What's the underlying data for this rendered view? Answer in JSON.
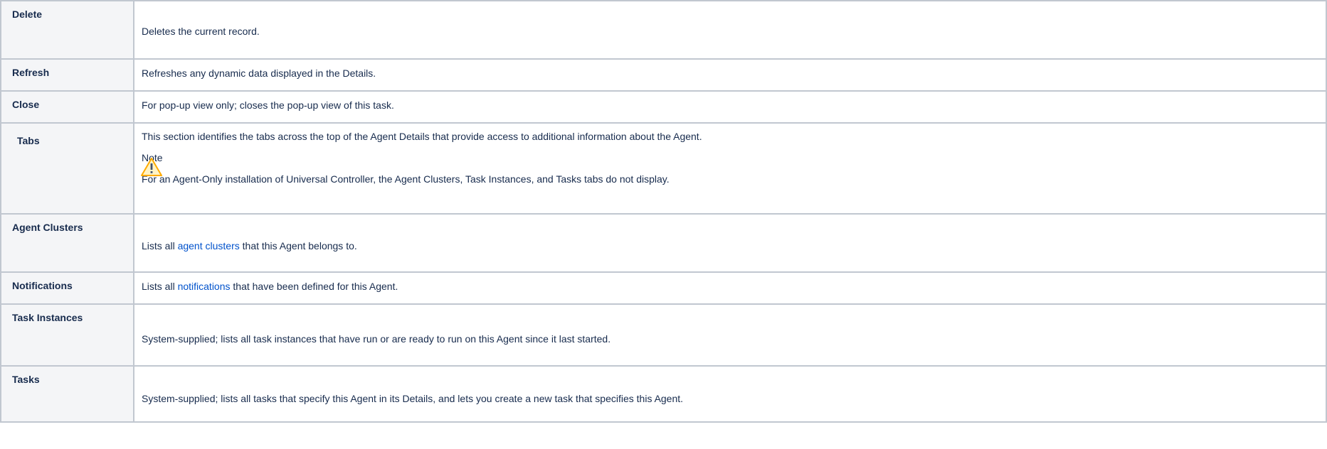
{
  "rows": {
    "delete": {
      "key": "Delete",
      "desc": "Deletes the current record."
    },
    "refresh": {
      "key": "Refresh",
      "desc": "Refreshes any dynamic data displayed in the Details."
    },
    "close": {
      "key": "Close",
      "desc": "For pop-up view only; closes the pop-up view of this task."
    },
    "tabs": {
      "key": "Tabs",
      "desc": "This section identifies the tabs across the top of the Agent Details that provide access to additional information about the Agent.",
      "note_title": "Note",
      "note_icon": "warning-icon",
      "note_body": "For an Agent-Only installation of Universal Controller, the Agent Clusters, Task Instances, and Tasks tabs do not display."
    },
    "agent_clusters": {
      "key": "Agent Clusters",
      "pre": "Lists all ",
      "link": "agent clusters",
      "post": " that this Agent belongs to."
    },
    "notifications": {
      "key": "Notifications",
      "pre": "Lists all ",
      "link": "notifications",
      "post": " that have been defined for this Agent."
    },
    "task_instances": {
      "key": "Task Instances",
      "desc": "System-supplied; lists all task instances that have run or are ready to run on this Agent since it last started."
    },
    "tasks": {
      "key": "Tasks",
      "desc": "System-supplied; lists all tasks that specify this Agent in its Details, and lets you create a new task that specifies this Agent."
    }
  },
  "colors": {
    "link": "#0052cc",
    "key_bg": "#f4f5f7",
    "border": "#c1c7d0",
    "warning": "#ffab00"
  }
}
